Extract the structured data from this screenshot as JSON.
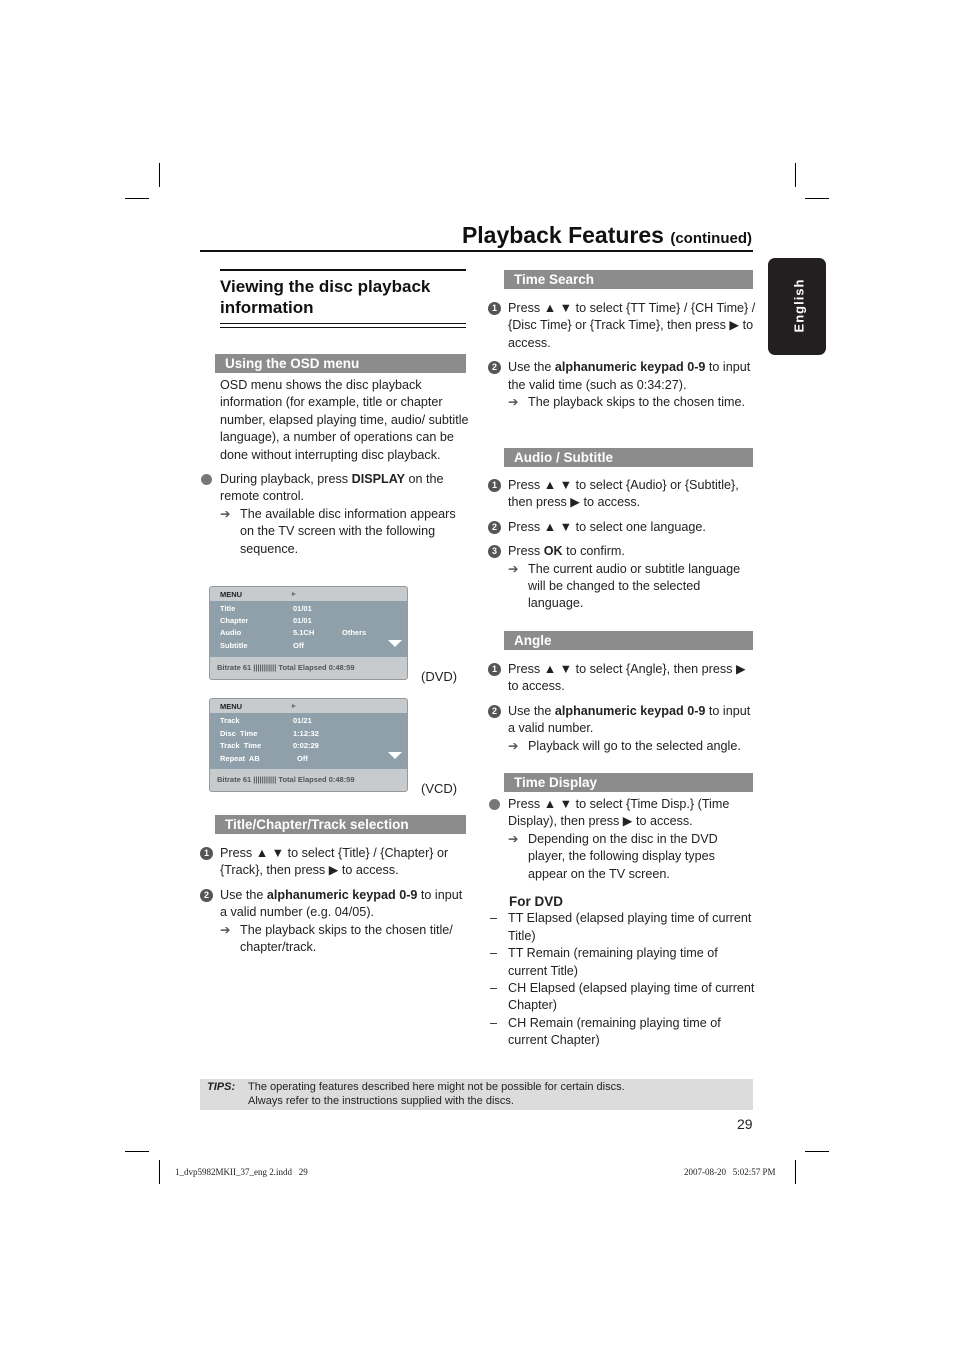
{
  "header": {
    "title": "Playback Features",
    "continued": "(continued)"
  },
  "language_tab": "English",
  "left": {
    "section_title": "Viewing the disc playback information",
    "osd_header": "Using the OSD menu",
    "osd_intro": "OSD menu shows the disc playback information (for example, title or chapter number, elapsed playing time, audio/ subtitle language), a number of operations can be done without interrupting disc playback.",
    "osd_step": {
      "pre": "During playback, press ",
      "bold": "DISPLAY",
      "post": " on the remote control."
    },
    "osd_result": "The available disc information appears on the TV screen with the following sequence.",
    "dvd_menu": {
      "header": "MENU",
      "rows": [
        [
          "Title",
          "01/01",
          ""
        ],
        [
          "Chapter",
          "01/01",
          ""
        ],
        [
          "Audio",
          "5.1CH",
          "Others"
        ],
        [
          "Subtitle",
          "Off",
          ""
        ]
      ],
      "footer": "Bitrate   61  |||||||||||    Total Elapsed   0:48:59",
      "caption": "(DVD)"
    },
    "vcd_menu": {
      "header": "MENU",
      "rows": [
        [
          "Track",
          "01/21"
        ],
        [
          "Disc  Time",
          "1:12:32"
        ],
        [
          "Track  Time",
          "0:02:29"
        ],
        [
          "Repeat  AB",
          "Off"
        ]
      ],
      "footer": "Bitrate   61  |||||||||||    Total Elapsed   0:48:59",
      "caption": "(VCD)"
    },
    "tct_header": "Title/Chapter/Track selection",
    "tct_step1": "Press ▲ ▼ to select {Title} / {Chapter} or {Track}, then press ▶ to access.",
    "tct_step2": {
      "pre": "Use the ",
      "bold": "alphanumeric keypad 0-9",
      "post": " to input a valid number (e.g. 04/05)."
    },
    "tct_result": "The playback skips to the chosen title/ chapter/track."
  },
  "right": {
    "time_search": {
      "header": "Time Search",
      "step1": "Press ▲ ▼ to select {TT Time} / {CH Time} / {Disc Time} or {Track Time}, then press ▶ to access.",
      "step2": {
        "pre": "Use the ",
        "bold": "alphanumeric keypad 0-9",
        "post": " to input the valid time (such as 0:34:27)."
      },
      "result": "The playback skips to the chosen time."
    },
    "audio_subtitle": {
      "header": "Audio / Subtitle",
      "step1": "Press ▲ ▼ to select {Audio} or {Subtitle}, then press ▶ to access.",
      "step2": "Press ▲ ▼ to select one language.",
      "step3": {
        "pre": "Press ",
        "bold": "OK",
        "post": " to confirm."
      },
      "result": "The current audio or subtitle language will be changed to the selected language."
    },
    "angle": {
      "header": "Angle",
      "step1": "Press ▲ ▼ to select {Angle}, then press ▶ to access.",
      "step2": {
        "pre": "Use the ",
        "bold": "alphanumeric keypad 0-9",
        "post": " to input a valid number."
      },
      "result": "Playback will go to the selected angle."
    },
    "time_display": {
      "header": "Time Display",
      "step1": "Press ▲ ▼ to select {Time Disp.} (Time Display), then press ▶ to access.",
      "result": "Depending on the disc in the DVD player, the following display types appear on the TV screen.",
      "for_dvd": "For DVD",
      "options": [
        "TT Elapsed (elapsed playing time of current Title)",
        "TT Remain (remaining playing time of current Title)",
        "CH Elapsed (elapsed playing time of current Chapter)",
        "CH Remain (remaining playing time of current Chapter)"
      ]
    }
  },
  "tips": {
    "label": "TIPS:",
    "line1": "The operating features described here might not be possible for certain discs.",
    "line2": "Always refer to the instructions supplied with the discs."
  },
  "page_number": "29",
  "footer": {
    "file": "1_dvp5982MKII_37_eng 2.indd   29",
    "date": "2007-08-20   5:02:57 PM"
  }
}
